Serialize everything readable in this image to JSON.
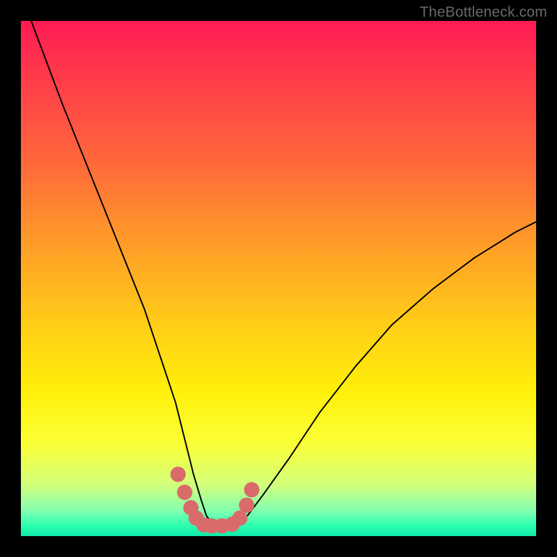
{
  "watermark": "TheBottleneck.com",
  "chart_data": {
    "type": "line",
    "title": "",
    "xlabel": "",
    "ylabel": "",
    "xlim": [
      0,
      100
    ],
    "ylim": [
      0,
      100
    ],
    "series": [
      {
        "name": "bottleneck-curve",
        "x": [
          2,
          5,
          8,
          12,
          16,
          20,
          24,
          27,
          30,
          32,
          33.5,
          35,
          36,
          37,
          38,
          40,
          42,
          44,
          47,
          52,
          58,
          65,
          72,
          80,
          88,
          96,
          100
        ],
        "values": [
          100,
          92,
          84,
          74,
          64,
          54,
          44,
          35,
          26,
          18,
          12,
          7,
          4,
          2.5,
          2,
          2,
          2.5,
          4,
          8,
          15,
          24,
          33,
          41,
          48,
          54,
          59,
          61
        ]
      }
    ],
    "highlight_region": {
      "name": "optimal-range-markers",
      "x": [
        30.5,
        31.8,
        33,
        34,
        35.5,
        37,
        39,
        41,
        42.5,
        43.8,
        44.8
      ],
      "values": [
        12,
        8.5,
        5.5,
        3.5,
        2.2,
        2,
        2,
        2.3,
        3.5,
        6,
        9
      ]
    },
    "background_gradient": {
      "top": "#ff1a54",
      "mid": "#ffe000",
      "bottom": "#10e8a8"
    }
  }
}
